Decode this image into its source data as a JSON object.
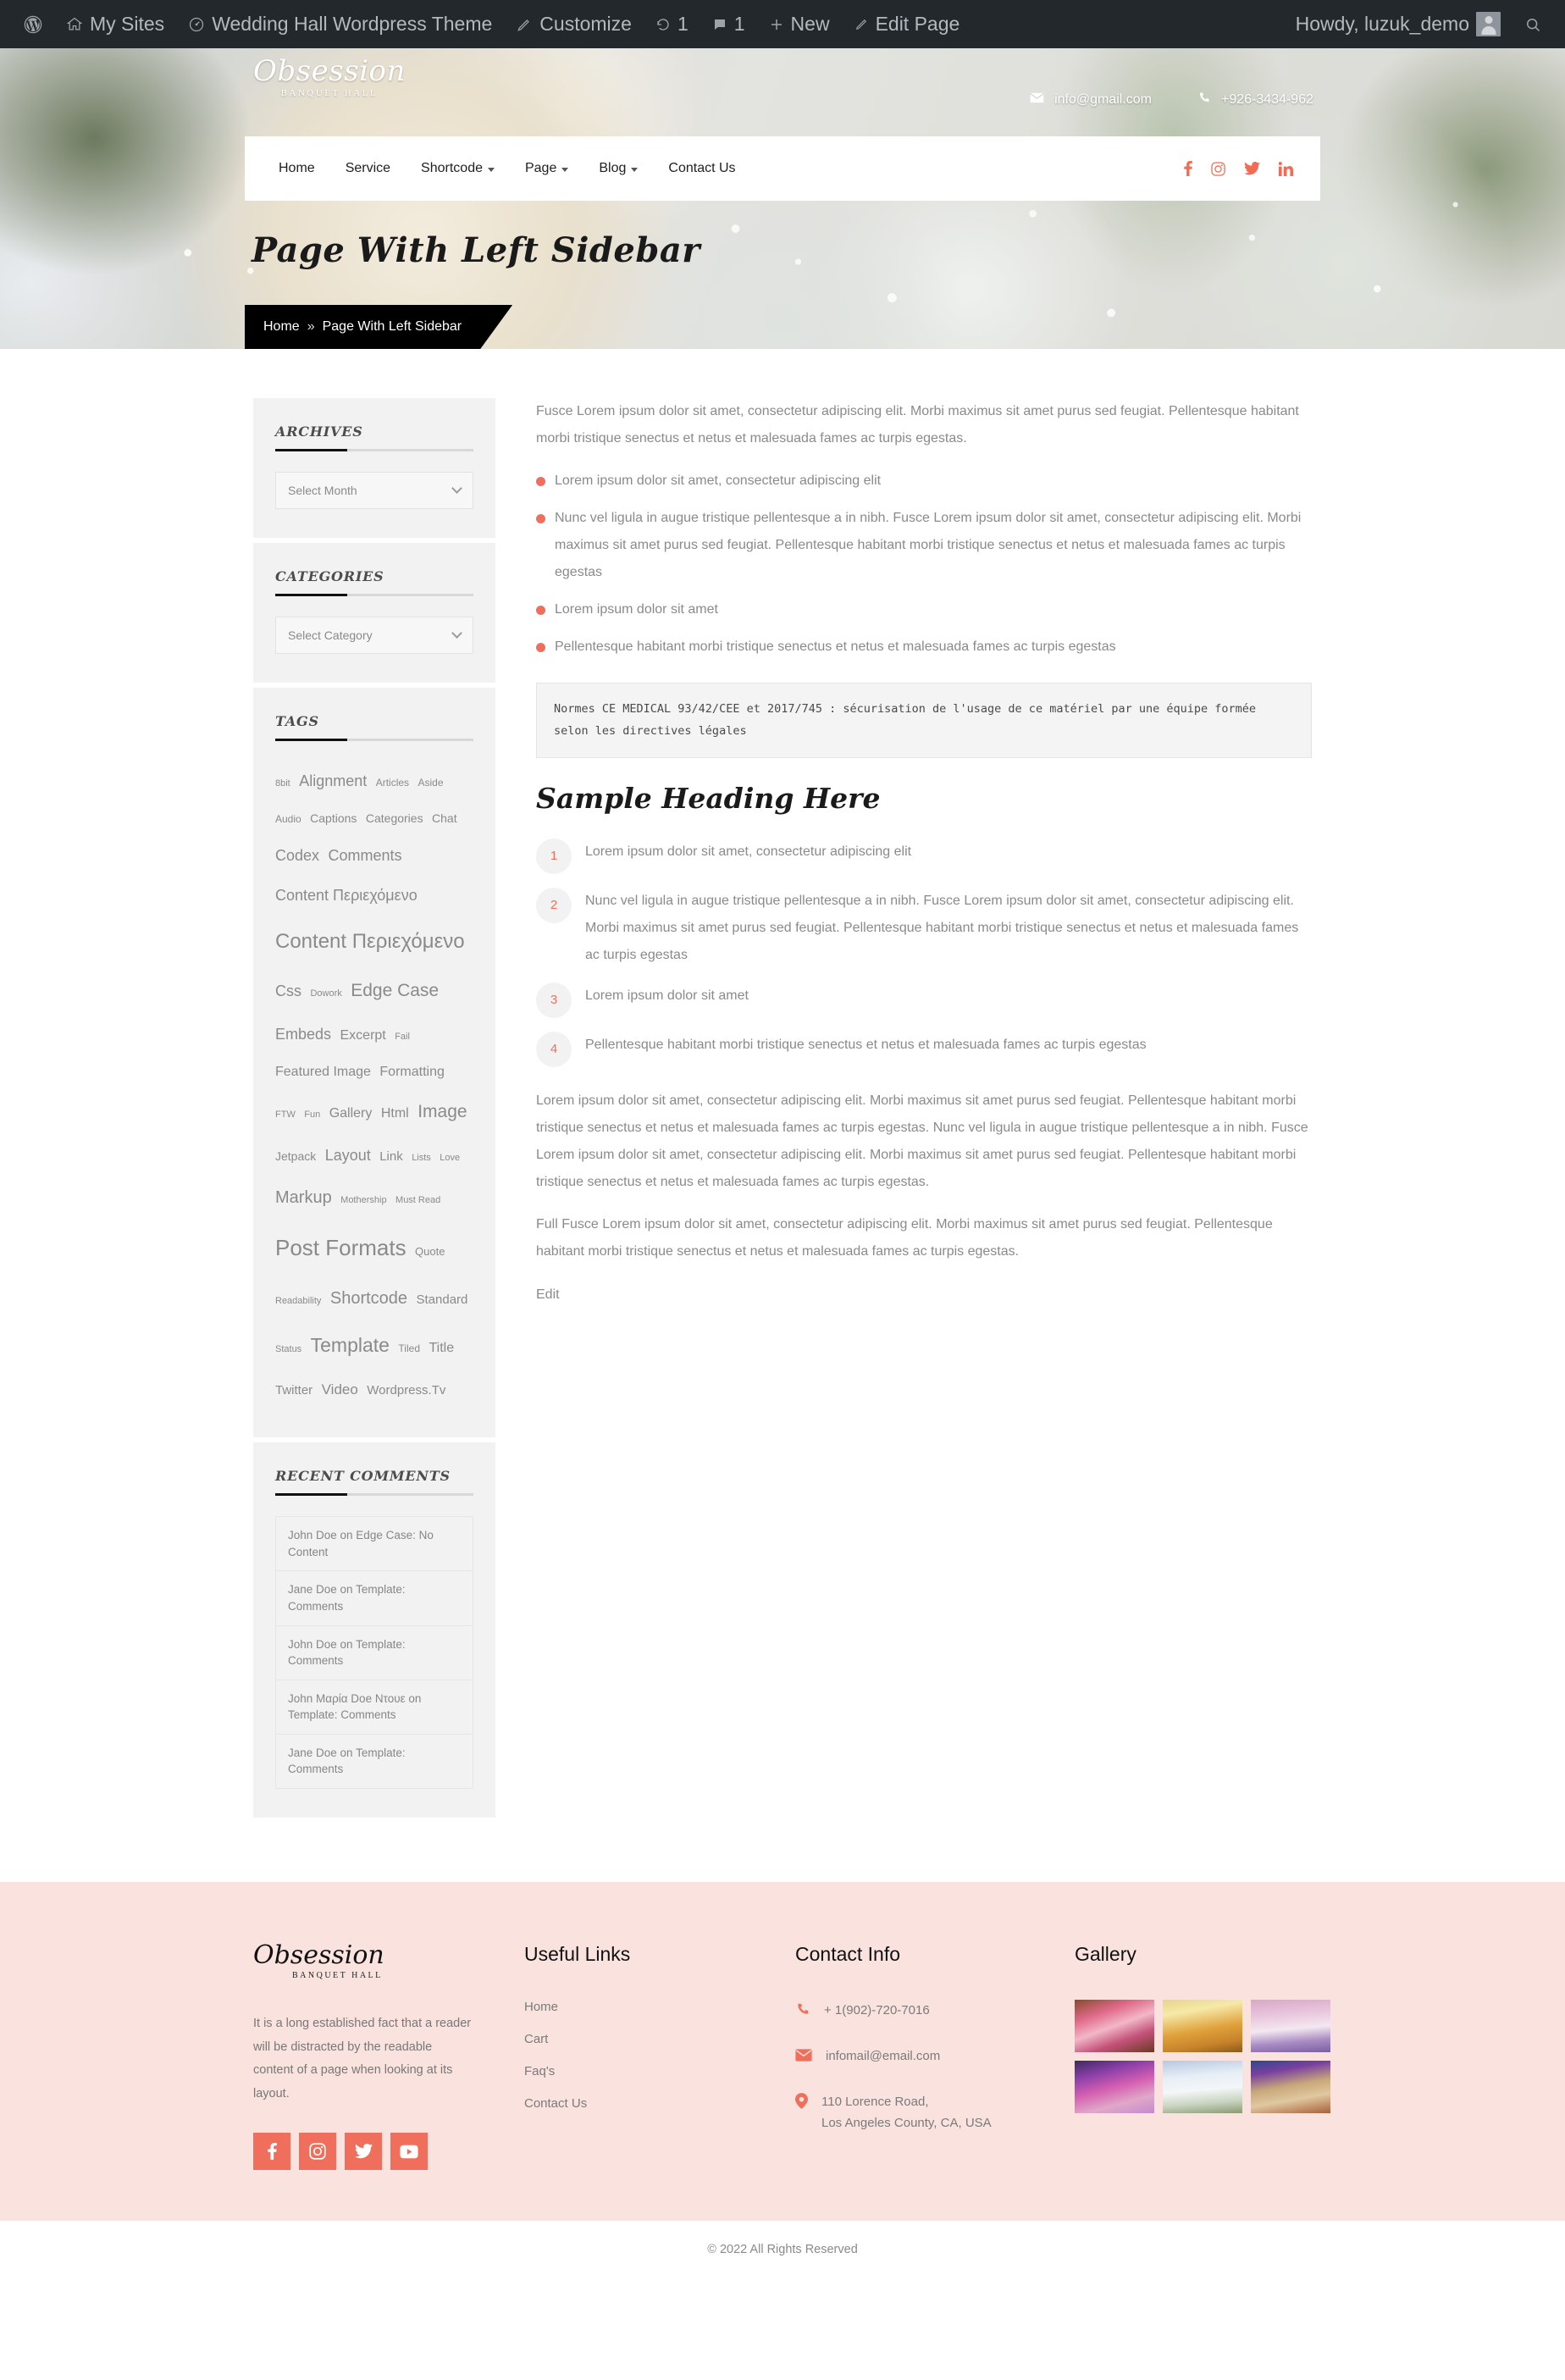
{
  "adminbar": {
    "left_items": [
      {
        "icon": "wordpress-logo-icon",
        "label": ""
      },
      {
        "icon": "my-sites-icon",
        "label": "My Sites"
      },
      {
        "icon": "dashboard-icon",
        "label": "Wedding Hall Wordpress Theme"
      },
      {
        "icon": "customize-pencil-icon",
        "label": "Customize"
      },
      {
        "icon": "revisions-icon",
        "label": "1"
      },
      {
        "icon": "comment-bubble-icon",
        "label": "1"
      },
      {
        "icon": "plus-icon",
        "label": "New"
      },
      {
        "icon": "edit-pencil-icon",
        "label": "Edit Page"
      }
    ],
    "greeting": "Howdy, luzuk_demo",
    "search_icon": "search-icon"
  },
  "header": {
    "brand_name": "Obsession",
    "brand_sub": "Banquet Hall",
    "email": "info@gmail.com",
    "phone": "+926-3434-962",
    "menu": [
      {
        "label": "Home",
        "has_dropdown": false
      },
      {
        "label": "Service",
        "has_dropdown": false
      },
      {
        "label": "Shortcode",
        "has_dropdown": true
      },
      {
        "label": "Page",
        "has_dropdown": true
      },
      {
        "label": "Blog",
        "has_dropdown": true
      },
      {
        "label": "Contact Us",
        "has_dropdown": false
      }
    ],
    "social": [
      "facebook-icon",
      "instagram-icon",
      "twitter-icon",
      "linkedin-icon"
    ],
    "accent_color": "#ef6f5c"
  },
  "hero": {
    "title": "Page With Left Sidebar",
    "breadcrumb_home": "Home",
    "breadcrumb_sep": "»",
    "breadcrumb_current": "Page With Left Sidebar"
  },
  "sidebar": {
    "archives": {
      "title": "Archives",
      "select_value": "Select Month"
    },
    "categories": {
      "title": "Categories",
      "select_value": "Select Category"
    },
    "tags": {
      "title": "Tags",
      "items": [
        {
          "label": "8bit",
          "size": 11
        },
        {
          "label": "Alignment",
          "size": 18
        },
        {
          "label": "Articles",
          "size": 12
        },
        {
          "label": "Aside",
          "size": 12
        },
        {
          "label": "Audio",
          "size": 12
        },
        {
          "label": "Captions",
          "size": 14
        },
        {
          "label": "Categories",
          "size": 14
        },
        {
          "label": "Chat",
          "size": 14
        },
        {
          "label": "Codex",
          "size": 18
        },
        {
          "label": "Comments",
          "size": 18
        },
        {
          "label": "Content Περιεχόμενο",
          "size": 18
        },
        {
          "label": "Content Περιεχόμενο",
          "size": 24
        },
        {
          "label": "Css",
          "size": 18
        },
        {
          "label": "Dowork",
          "size": 11
        },
        {
          "label": "Edge Case",
          "size": 21
        },
        {
          "label": "Embeds",
          "size": 18
        },
        {
          "label": "Excerpt",
          "size": 16
        },
        {
          "label": "Fail",
          "size": 11
        },
        {
          "label": "Featured Image",
          "size": 16
        },
        {
          "label": "Formatting",
          "size": 16
        },
        {
          "label": "FTW",
          "size": 11
        },
        {
          "label": "Fun",
          "size": 11
        },
        {
          "label": "Gallery",
          "size": 16
        },
        {
          "label": "Html",
          "size": 16
        },
        {
          "label": "Image",
          "size": 21
        },
        {
          "label": "Jetpack",
          "size": 14
        },
        {
          "label": "Layout",
          "size": 18
        },
        {
          "label": "Link",
          "size": 15
        },
        {
          "label": "Lists",
          "size": 11
        },
        {
          "label": "Love",
          "size": 11
        },
        {
          "label": "Markup",
          "size": 20
        },
        {
          "label": "Mothership",
          "size": 11
        },
        {
          "label": "Must Read",
          "size": 11
        },
        {
          "label": "Post Formats",
          "size": 26
        },
        {
          "label": "Quote",
          "size": 13
        },
        {
          "label": "Readability",
          "size": 11
        },
        {
          "label": "Shortcode",
          "size": 20
        },
        {
          "label": "Standard",
          "size": 15
        },
        {
          "label": "Status",
          "size": 11
        },
        {
          "label": "Template",
          "size": 23
        },
        {
          "label": "Tiled",
          "size": 12
        },
        {
          "label": "Title",
          "size": 16
        },
        {
          "label": "Twitter",
          "size": 15
        },
        {
          "label": "Video",
          "size": 17
        },
        {
          "label": "Wordpress.Tv",
          "size": 15
        }
      ]
    },
    "recent_comments": {
      "title": "Recent Comments",
      "items": [
        "John Doe on Edge Case: No Content",
        "Jane Doe on Template: Comments",
        "John Doe on Template: Comments",
        "John Μαρία Doe Ντουε on Template: Comments",
        "Jane Doe on Template: Comments"
      ]
    }
  },
  "content": {
    "intro_paragraph": "Fusce Lorem ipsum dolor sit amet, consectetur adipiscing elit. Morbi maximus sit amet purus sed feugiat. Pellentesque habitant morbi tristique senectus et netus et malesuada fames ac turpis egestas.",
    "bullet_list": [
      "Lorem ipsum dolor sit amet, consectetur adipiscing elit",
      "Nunc vel ligula in augue tristique pellentesque a in nibh. Fusce Lorem ipsum dolor sit amet, consectetur adipiscing elit. Morbi maximus sit amet purus sed feugiat. Pellentesque habitant morbi tristique senectus et netus et malesuada fames ac turpis egestas",
      "Lorem ipsum dolor sit amet",
      "Pellentesque habitant morbi tristique senectus et netus et malesuada fames ac turpis egestas"
    ],
    "code_block": "Normes CE MEDICAL 93/42/CEE et 2017/745 : sécurisation de l'usage de ce matériel par une équipe formée selon les directives légales",
    "heading": "Sample Heading Here",
    "numbered_list": [
      {
        "number": "1",
        "text": "Lorem ipsum dolor sit amet, consectetur adipiscing elit"
      },
      {
        "number": "2",
        "text": "Nunc vel ligula in augue tristique pellentesque a in nibh. Fusce Lorem ipsum dolor sit amet, consectetur adipiscing elit. Morbi maximus sit amet purus sed feugiat. Pellentesque habitant morbi tristique senectus et netus et malesuada fames ac turpis egestas"
      },
      {
        "number": "3",
        "text": "Lorem ipsum dolor sit amet"
      },
      {
        "number": "4",
        "text": "Pellentesque habitant morbi tristique senectus et netus et malesuada fames ac turpis egestas"
      }
    ],
    "paragraph_2": "Lorem ipsum dolor sit amet, consectetur adipiscing elit. Morbi maximus sit amet purus sed feugiat. Pellentesque habitant morbi tristique senectus et netus et malesuada fames ac turpis egestas. Nunc vel ligula in augue tristique pellentesque a in nibh. Fusce Lorem ipsum dolor sit amet, consectetur adipiscing elit. Morbi maximus sit amet purus sed feugiat. Pellentesque habitant morbi tristique senectus et netus et malesuada fames ac turpis egestas.",
    "paragraph_3": "Full Fusce Lorem ipsum dolor sit amet, consectetur adipiscing elit. Morbi maximus sit amet purus sed feugiat. Pellentesque habitant morbi tristique senectus et netus et malesuada fames ac turpis egestas.",
    "edit_link": "Edit"
  },
  "footer": {
    "brand_name": "Obsession",
    "brand_sub": "Banquet Hall",
    "about_text": "It is a long established fact that a reader will be distracted by the readable content of a page when looking at its layout.",
    "social": [
      "facebook-icon",
      "instagram-icon",
      "twitter-icon",
      "youtube-icon"
    ],
    "useful_links": {
      "title": "Useful Links",
      "items": [
        "Home",
        "Cart",
        "Faq's",
        "Contact Us"
      ]
    },
    "contact_info": {
      "title": "Contact Info",
      "phone": "+ 1(902)-720-7016",
      "email": "infomail@email.com",
      "address_line1": "110 Lorence Road,",
      "address_line2": "Los Angeles County, CA, USA"
    },
    "gallery": {
      "title": "Gallery",
      "count": 6
    },
    "background_color": "#fae3df"
  },
  "copyright": {
    "text": "© 2022 All Rights Reserved"
  }
}
